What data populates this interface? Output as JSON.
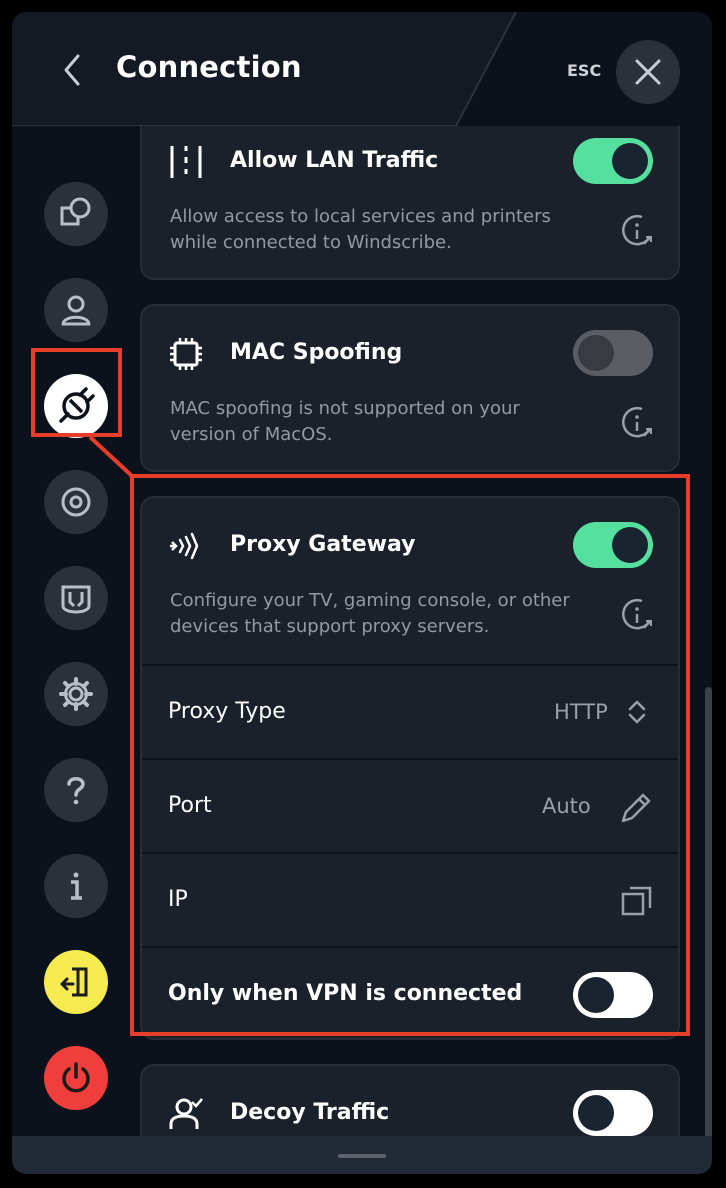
{
  "header": {
    "title": "Connection",
    "esc_label": "ESC"
  },
  "sidebar": {
    "items": [
      {
        "name": "nav-locations-icon"
      },
      {
        "name": "nav-account-icon"
      },
      {
        "name": "nav-connection-icon",
        "active": true
      },
      {
        "name": "nav-robert-icon"
      },
      {
        "name": "nav-advanced-icon"
      },
      {
        "name": "nav-settings-icon"
      },
      {
        "name": "nav-help-icon"
      },
      {
        "name": "nav-about-icon"
      },
      {
        "name": "nav-logout-icon"
      },
      {
        "name": "nav-quit-icon"
      }
    ]
  },
  "cards": {
    "lan": {
      "title": "Allow LAN Traffic",
      "desc": "Allow access to local services and printers while connected to Windscribe.",
      "toggle": "on"
    },
    "mac": {
      "title": "MAC Spoofing",
      "desc": "MAC spoofing is not supported on your version of MacOS.",
      "toggle": "off"
    },
    "proxy": {
      "title": "Proxy Gateway",
      "desc": "Configure your TV, gaming console, or other devices that support proxy servers.",
      "toggle": "on",
      "proxy_type_label": "Proxy Type",
      "proxy_type_value": "HTTP",
      "port_label": "Port",
      "port_value": "Auto",
      "ip_label": "IP",
      "only_vpn_label": "Only when VPN is connected",
      "only_vpn_toggle": "off"
    },
    "decoy": {
      "title": "Decoy Traffic",
      "toggle": "off"
    }
  },
  "colors": {
    "background": "#0b121b",
    "card": "#1a212b",
    "toggle_on": "#55e0a0",
    "highlight": "#e63e2a",
    "logout": "#f5ea50",
    "quit": "#ef3e3b"
  }
}
